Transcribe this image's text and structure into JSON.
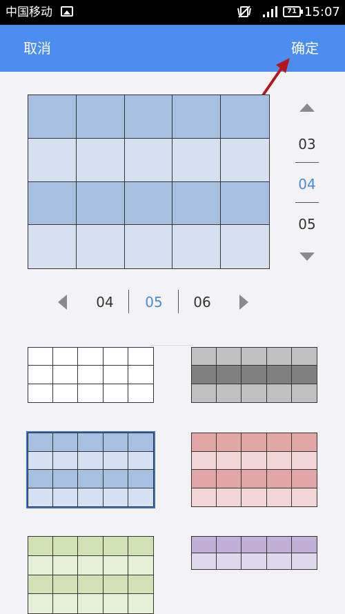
{
  "status_bar": {
    "carrier": "中国移动",
    "battery": "71",
    "time": "15:07"
  },
  "top_bar": {
    "cancel_label": "取消",
    "confirm_label": "确定"
  },
  "rows_picker": {
    "values": [
      "03",
      "04",
      "05"
    ],
    "selected": "04"
  },
  "cols_picker": {
    "values": [
      "04",
      "05",
      "06"
    ],
    "selected": "05"
  },
  "preview": {
    "columns": 5,
    "rows": 4,
    "row_colors": [
      "#a7bfe0",
      "#d6e0f1",
      "#a7bfe0",
      "#d6e0f1"
    ]
  },
  "styles": [
    {
      "name": "white",
      "row_colors": [
        "#ffffff",
        "#ffffff",
        "#ffffff"
      ]
    },
    {
      "name": "gray",
      "row_colors": [
        "#c0c0c0",
        "#808080",
        "#c0c0c0"
      ]
    },
    {
      "name": "blue",
      "row_colors": [
        "#a7bfe0",
        "#d6e0f1",
        "#a7bfe0",
        "#d6e0f1"
      ],
      "selected": true
    },
    {
      "name": "red",
      "row_colors": [
        "#e3a6a6",
        "#f1d6d6",
        "#e3a6a6",
        "#f1d6d6"
      ]
    },
    {
      "name": "green",
      "row_colors": [
        "#d0e1b3",
        "#e6f0d8",
        "#d0e1b3",
        "#e6f0d8"
      ]
    },
    {
      "name": "purple",
      "row_colors": [
        "#bfb0d8",
        "#ded6eb"
      ]
    }
  ],
  "colors": {
    "accent": "#4c8ef0",
    "selected_value": "#4c8ad6",
    "annotation_arrow": "#b3171c"
  }
}
